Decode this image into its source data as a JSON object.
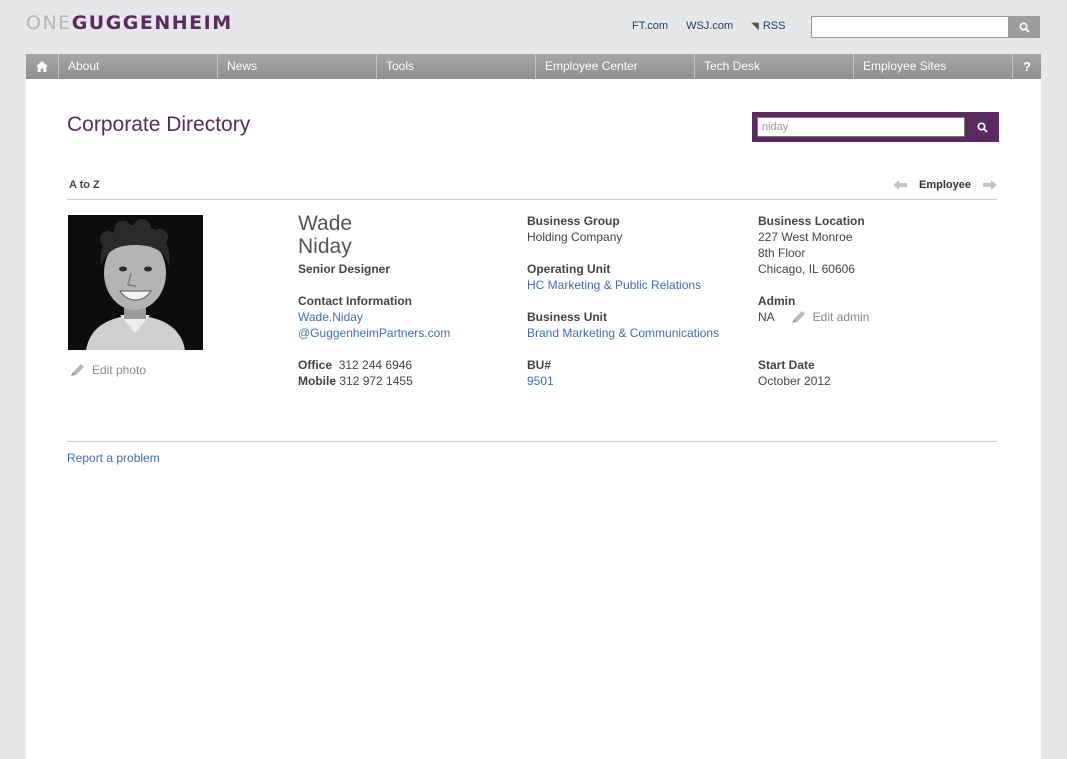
{
  "logo": {
    "one": "ONE",
    "guggenheim": "GUGGENHEIM"
  },
  "toplinks": {
    "ft": "FT.com",
    "wsj": "WSJ.com",
    "rss": "RSS"
  },
  "nav": {
    "items": [
      "About",
      "News",
      "Tools",
      "Employee Center",
      "Tech Desk",
      "Employee Sites"
    ],
    "help": "?"
  },
  "page": {
    "title": "Corporate Directory"
  },
  "search": {
    "value": "niday"
  },
  "subnav": {
    "atoz": "A to Z",
    "employee": "Employee"
  },
  "profile": {
    "first_name": "Wade",
    "last_name": "Niday",
    "job_title": "Senior Designer",
    "edit_photo": "Edit photo",
    "contact_label": "Contact Information",
    "email_line1": "Wade.Niday",
    "email_line2": "@GuggenheimPartners.com",
    "office_label": "Office",
    "office_phone": "312 244 6946",
    "mobile_label": "Mobile",
    "mobile_phone": "312 972 1455",
    "business_group_label": "Business Group",
    "business_group": "Holding Company",
    "operating_unit_label": "Operating Unit",
    "operating_unit": "HC Marketing & Public Relations",
    "business_unit_label": "Business Unit",
    "business_unit": "Brand Marketing & Communications",
    "bu_label": "BU#",
    "bu_number": "9501",
    "location_label": "Business Location",
    "location_line1": "227 West Monroe",
    "location_line2": "8th Floor",
    "location_line3": "Chicago, IL 60606",
    "admin_label": "Admin",
    "admin_value": "NA",
    "edit_admin": "Edit admin",
    "start_label": "Start Date",
    "start_date": "October 2012"
  },
  "footer": {
    "report": "Report a problem"
  },
  "colors": {
    "brand_purple": "#5b2a5e",
    "link_blue": "#3f6fb0",
    "nav_grey": "#9a9a9d"
  }
}
